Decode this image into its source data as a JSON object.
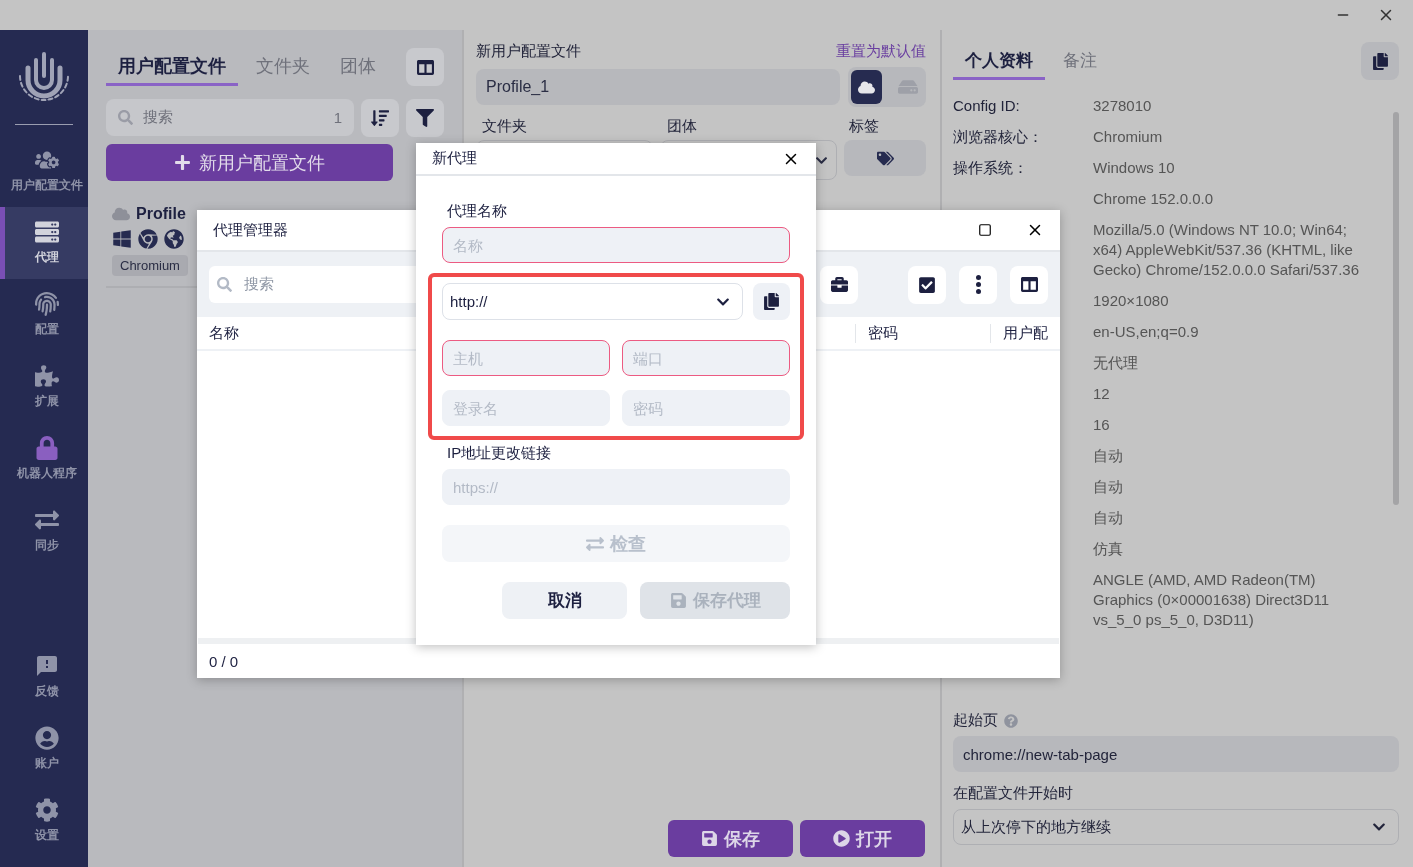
{
  "sidebar": {
    "items": [
      {
        "label": "用户配置文件",
        "kind": "profiles",
        "selected": false
      },
      {
        "label": "代理",
        "kind": "proxy",
        "selected": true
      },
      {
        "label": "配置",
        "kind": "fingerprint",
        "selected": false
      },
      {
        "label": "扩展",
        "kind": "extensions",
        "selected": false
      },
      {
        "label": "机器人程序",
        "kind": "lock",
        "selected": false
      },
      {
        "label": "同步",
        "kind": "sync",
        "selected": false
      }
    ],
    "bottom_items": [
      {
        "label": "反馈",
        "kind": "feedback",
        "selected": false
      },
      {
        "label": "账户",
        "kind": "account",
        "selected": false
      },
      {
        "label": "设置",
        "kind": "settings",
        "selected": false
      }
    ]
  },
  "profiles_panel": {
    "tabs": [
      {
        "label": "用户配置文件",
        "selected": true
      },
      {
        "label": "文件夹",
        "selected": false
      },
      {
        "label": "团体",
        "selected": false
      }
    ],
    "search": {
      "placeholder": "搜索",
      "count": "1"
    },
    "new_button": "新用户配置文件",
    "profile": {
      "name": "Profile",
      "browser_tag": "Chromium"
    }
  },
  "editor": {
    "title": "新用户配置文件",
    "reset_link": "重置为默认值",
    "name_value": "Profile_1",
    "storage_options": [
      {
        "kind": "cloud",
        "selected": true
      },
      {
        "kind": "local",
        "selected": false
      }
    ],
    "folder_label": "文件夹",
    "group_label": "团体",
    "tags_label": "标签",
    "save_button": "保存",
    "open_button": "打开"
  },
  "details": {
    "tabs": [
      {
        "label": "个人资料",
        "selected": true
      },
      {
        "label": "备注",
        "selected": false
      }
    ],
    "rows": [
      {
        "label": "Config ID:",
        "value": "3278010"
      },
      {
        "label": "浏览器核心：",
        "value": "Chromium"
      },
      {
        "label": "操作系统：",
        "value": "Windows 10"
      },
      {
        "value": "Chrome 152.0.0.0"
      },
      {
        "value": "Mozilla/5.0 (Windows NT 10.0; Win64; x64) AppleWebKit/537.36 (KHTML, like Gecko) Chrome/152.0.0.0 Safari/537.36"
      },
      {
        "value": "1920×1080"
      },
      {
        "value": "en-US,en;q=0.9"
      },
      {
        "value": "无代理"
      },
      {
        "value": "12"
      },
      {
        "value": "16"
      },
      {
        "value": "自动"
      },
      {
        "value": "自动"
      },
      {
        "value": "自动"
      },
      {
        "value": "仿真"
      },
      {
        "value": "ANGLE (AMD, AMD Radeon(TM) Graphics (0×00001638) Direct3D11 vs_5_0 ps_5_0, D3D11)"
      }
    ],
    "start_page_label": "起始页",
    "start_page_value": "chrome://new-tab-page",
    "on_start_label": "在配置文件开始时",
    "on_start_value": "从上次停下的地方继续"
  },
  "proxy_manager": {
    "title": "代理管理器",
    "search_placeholder": "搜索",
    "columns": [
      "名称",
      "密码",
      "用户配"
    ],
    "footer": "0 / 0"
  },
  "new_proxy": {
    "title": "新代理",
    "name_label": "代理名称",
    "name_field": {
      "placeholder": "名称",
      "invalid": true
    },
    "protocol": "http://",
    "fields": [
      {
        "placeholder": "主机",
        "invalid": true
      },
      {
        "placeholder": "端口",
        "invalid": true
      },
      {
        "placeholder": "登录名",
        "invalid": false
      },
      {
        "placeholder": "密码",
        "invalid": false
      }
    ],
    "ip_link_label": "IP地址更改链接",
    "ip_link_placeholder": "https://",
    "check_button": {
      "label": "检查",
      "disabled": true
    },
    "cancel_button": {
      "label": "取消",
      "disabled": false
    },
    "save_button": {
      "label": "保存代理",
      "disabled": true
    }
  }
}
